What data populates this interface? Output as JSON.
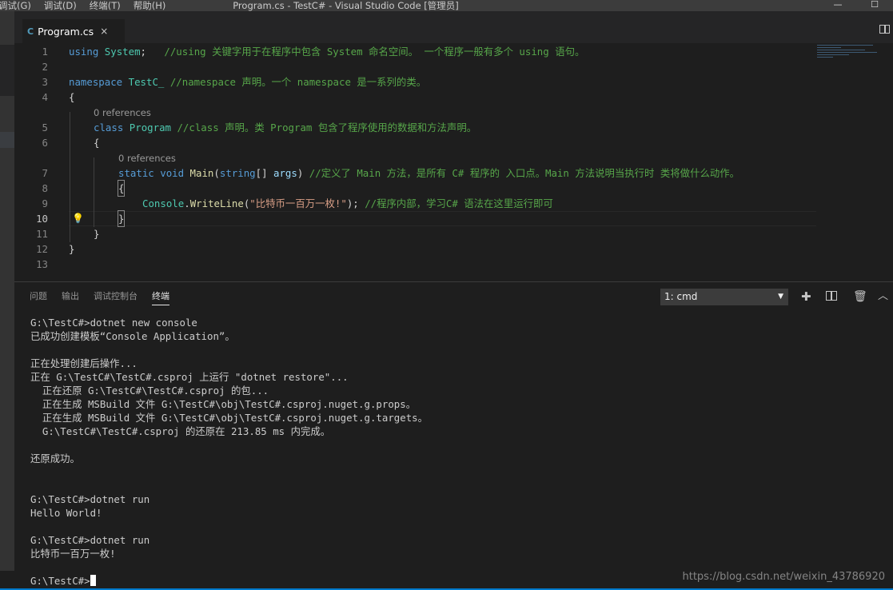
{
  "titlebar": {
    "menu": [
      "调试(G)",
      "调试(D)",
      "终端(T)",
      "帮助(H)"
    ],
    "title": "Program.cs - TestC# - Visual Studio Code [管理员]",
    "minimize": "—",
    "maximize": "☐"
  },
  "tab": {
    "icon": "C",
    "label": "Program.cs",
    "close": "×"
  },
  "editor": {
    "line_numbers": [
      "1",
      "2",
      "3",
      "4",
      "5",
      "6",
      "7",
      "8",
      "9",
      "10",
      "11",
      "12",
      "13"
    ],
    "codelens_1": "0 references",
    "codelens_2": "0 references",
    "l1": {
      "kw": "using",
      "ty": "System",
      "rest": ";   ",
      "cm": "//using 关键字用于在程序中包含 System 命名空间。 一个程序一般有多个 using 语句。"
    },
    "l3": {
      "kw": "namespace",
      "ty": "TestC_",
      "cm": "//namespace 声明。一个 namespace 是一系列的类。"
    },
    "l4": "{",
    "l5": {
      "kw": "class",
      "ty": "Program",
      "cm": "//class 声明。类 Program 包含了程序使用的数据和方法声明。"
    },
    "l6": "{",
    "l7": {
      "kw1": "static",
      "kw2": "void",
      "fn": "Main",
      "p1": "(",
      "kw3": "string",
      "p2": "[] ",
      "pr": "args",
      "p3": ") ",
      "cm": "//定义了 Main 方法，是所有 C# 程序的 入口点。Main 方法说明当执行时 类将做什么动作。"
    },
    "l8": "{",
    "l9": {
      "ty": "Console",
      "dot": ".",
      "fn": "WriteLine",
      "p1": "(",
      "st": "\"比特币一百万一枚!\"",
      "p2": "); ",
      "cm": "//程序内部，学习C# 语法在这里运行即可"
    },
    "l10": "}",
    "l11": "}",
    "l12": "}"
  },
  "panel": {
    "tabs": [
      "问题",
      "输出",
      "调试控制台",
      "终端"
    ],
    "terminal_select": "1: cmd",
    "terminal_lines": [
      "G:\\TestC#>dotnet new console",
      "已成功创建模板“Console Application”。",
      "",
      "正在处理创建后操作...",
      "正在 G:\\TestC#\\TestC#.csproj 上运行 \"dotnet restore\"...",
      "  正在还原 G:\\TestC#\\TestC#.csproj 的包...",
      "  正在生成 MSBuild 文件 G:\\TestC#\\obj\\TestC#.csproj.nuget.g.props。",
      "  正在生成 MSBuild 文件 G:\\TestC#\\obj\\TestC#.csproj.nuget.g.targets。",
      "  G:\\TestC#\\TestC#.csproj 的还原在 213.85 ms 内完成。",
      "",
      "还原成功。",
      "",
      "",
      "G:\\TestC#>dotnet run",
      "Hello World!",
      "",
      "G:\\TestC#>dotnet run",
      "比特币一百万一枚!",
      ""
    ],
    "prompt": "G:\\TestC#>",
    "watermark": "https://blog.csdn.net/weixin_43786920"
  }
}
